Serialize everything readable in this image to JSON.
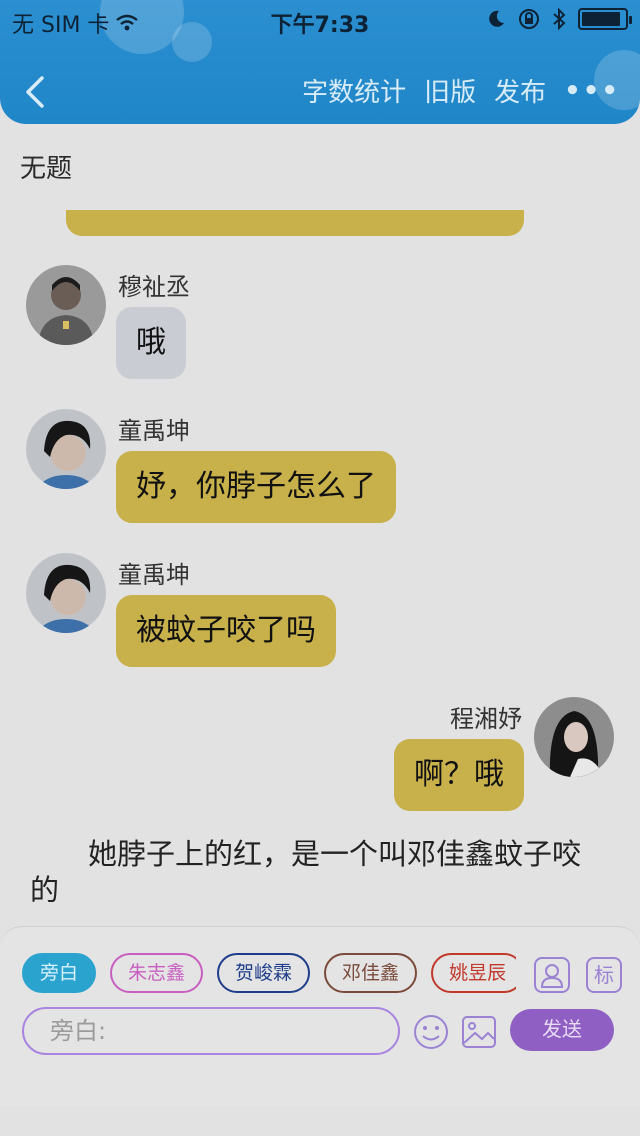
{
  "status": {
    "carrier": "无 SIM 卡",
    "time": "下午7:33",
    "battery_level": 0.9
  },
  "nav": {
    "word_count": "字数统计",
    "old_version": "旧版",
    "publish": "发布"
  },
  "doc": {
    "title": "无题"
  },
  "messages": [
    {
      "name": "穆祉丞",
      "text": "哦",
      "side": "left",
      "color": "gray"
    },
    {
      "name": "童禹坤",
      "text": "妤，你脖子怎么了",
      "side": "left",
      "color": "yellow"
    },
    {
      "name": "童禹坤",
      "text": "被蚊子咬了吗",
      "side": "left",
      "color": "yellow"
    },
    {
      "name": "程湘妤",
      "text": "啊？哦",
      "side": "right",
      "color": "yellow"
    }
  ],
  "narration": "她脖子上的红，是一个叫邓佳鑫蚊子咬的",
  "composer": {
    "roles": [
      {
        "label": "旁白",
        "color": "#2aa4cf"
      },
      {
        "label": "朱志鑫",
        "color": "#c85fc0"
      },
      {
        "label": "贺峻霖",
        "color": "#1f3d8a"
      },
      {
        "label": "邓佳鑫",
        "color": "#7a4a3a"
      },
      {
        "label": "姚昱辰",
        "color": "#c0392b"
      }
    ],
    "mark_label": "标",
    "placeholder": "旁白:",
    "send": "发送"
  }
}
